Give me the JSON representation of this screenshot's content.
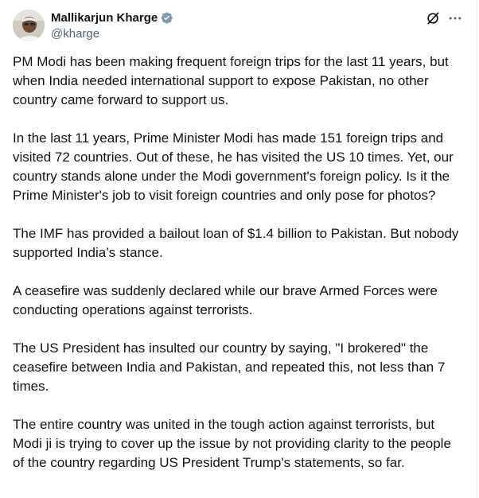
{
  "author": {
    "display_name": "Mallikarjun Kharge",
    "handle": "@kharge",
    "verified_color": "#829aab"
  },
  "toolbar": {
    "grok_icon": "grok-slash-icon",
    "more_icon": "more-dots-icon"
  },
  "tweet": {
    "paragraphs": [
      "PM Modi has been making frequent foreign trips for the last 11 years, but when India needed international support to expose Pakistan, no other country came forward to support us.",
      "In the last 11 years, Prime Minister Modi has made 151 foreign trips and visited 72 countries. Out of these, he has visited the US 10 times. Yet, our country stands alone under the Modi government's foreign policy. Is it the Prime Minister's job to visit foreign countries and only pose for photos?",
      "The IMF has provided a bailout loan of $1.4 billion to Pakistan. But nobody supported India’s stance.",
      "A ceasefire was suddenly declared while our brave Armed Forces were conducting operations against terrorists.",
      "The US President has insulted our country by saying, \"I brokered\" the ceasefire between India and Pakistan, and repeated this, not less than 7 times.",
      "The entire country was united in the tough action against terrorists, but Modi ji is trying to cover up the issue by not providing clarity to the people of the country regarding US President Trump's statements, so far."
    ]
  }
}
